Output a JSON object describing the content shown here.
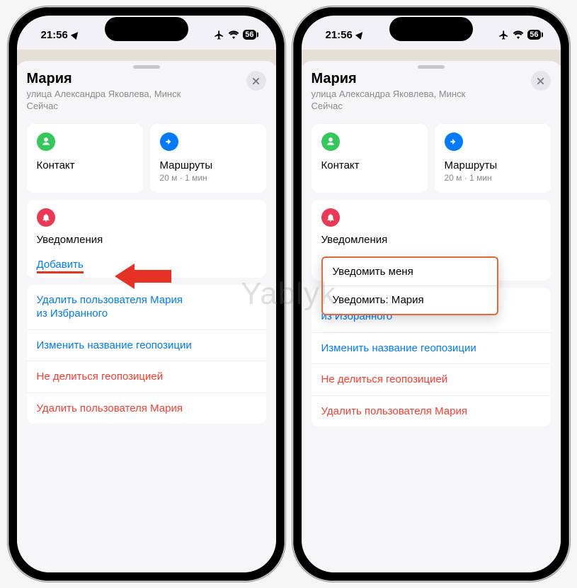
{
  "status": {
    "time": "21:56",
    "battery": "56"
  },
  "header": {
    "name": "Мария",
    "address": "улица Александра Яковлева, Минск",
    "now": "Сейчас"
  },
  "cards": {
    "contact": {
      "label": "Контакт"
    },
    "routes": {
      "label": "Маршруты",
      "sub": "20 м · 1 мин"
    }
  },
  "notifications": {
    "title": "Уведомления",
    "add": "Добавить"
  },
  "popup": {
    "notify_me": "Уведомить меня",
    "notify_contact": "Уведомить: Мария"
  },
  "actions": {
    "remove_favorite_l1": "Удалить пользователя Мария",
    "remove_favorite_l2": "из Избранного",
    "rename": "Изменить название геопозиции",
    "stop_sharing": "Не делиться геопозицией",
    "remove_user": "Удалить пользователя Мария"
  },
  "watermark": "Yablyk"
}
